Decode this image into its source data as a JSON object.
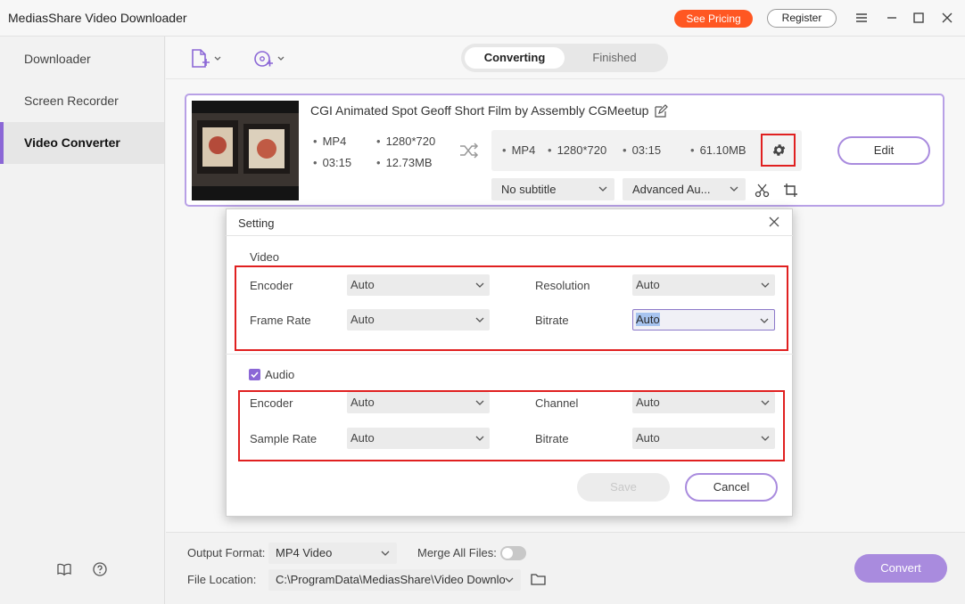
{
  "app": {
    "title": "MediasShare Video Downloader",
    "see_pricing": "See Pricing",
    "register": "Register"
  },
  "sidebar": {
    "items": [
      {
        "label": "Downloader"
      },
      {
        "label": "Screen Recorder"
      },
      {
        "label": "Video Converter",
        "active": true
      }
    ]
  },
  "tabs": {
    "converting": "Converting",
    "finished": "Finished"
  },
  "file": {
    "title": "CGI Animated Spot Geoff Short Film by Assembly  CGMeetup",
    "source": {
      "format": "MP4",
      "resolution": "1280*720",
      "duration": "03:15",
      "size": "12.73MB"
    },
    "target": {
      "format": "MP4",
      "resolution": "1280*720",
      "duration": "03:15",
      "size": "61.10MB"
    },
    "subtitle": "No subtitle",
    "audio_track": "Advanced Au...",
    "edit_label": "Edit"
  },
  "dialog": {
    "title": "Setting",
    "video_section": "Video",
    "video": {
      "encoder_label": "Encoder",
      "encoder_value": "Auto",
      "resolution_label": "Resolution",
      "resolution_value": "Auto",
      "frame_rate_label": "Frame Rate",
      "frame_rate_value": "Auto",
      "bitrate_label": "Bitrate",
      "bitrate_value": "Auto"
    },
    "audio_section": "Audio",
    "audio_checked": true,
    "audio": {
      "encoder_label": "Encoder",
      "encoder_value": "Auto",
      "channel_label": "Channel",
      "channel_value": "Auto",
      "sample_rate_label": "Sample Rate",
      "sample_rate_value": "Auto",
      "bitrate_label": "Bitrate",
      "bitrate_value": "Auto"
    },
    "save_label": "Save",
    "cancel_label": "Cancel"
  },
  "footer": {
    "output_format_label": "Output Format:",
    "output_format_value": "MP4 Video",
    "merge_label": "Merge All Files:",
    "merge_on": false,
    "file_location_label": "File Location:",
    "file_location_value": "C:\\ProgramData\\MediasShare\\Video Downloa",
    "convert_label": "Convert"
  },
  "colors": {
    "accent": "#a98bde",
    "pricing": "#ff5722",
    "highlight_box": "#e02020"
  }
}
